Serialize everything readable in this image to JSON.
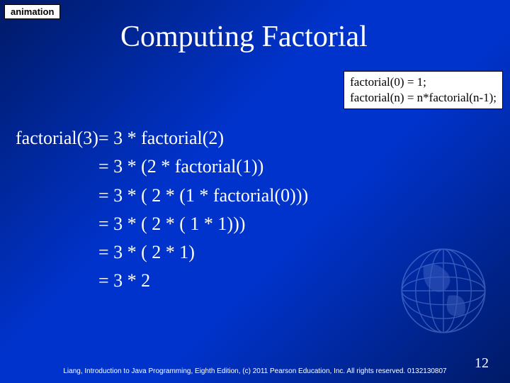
{
  "label": "animation",
  "title": "Computing Factorial",
  "definition": {
    "line1": "factorial(0) = 1;",
    "line2": "factorial(n) = n*factorial(n-1);"
  },
  "work": {
    "lhs": "factorial(3) ",
    "steps": [
      "= 3 * factorial(2)",
      "= 3 * (2 * factorial(1))",
      "= 3 * ( 2 * (1 * factorial(0)))",
      "= 3 * ( 2 * ( 1 * 1)))",
      "= 3 * ( 2 * 1)",
      "= 3 * 2"
    ]
  },
  "footer": "Liang, Introduction to Java Programming, Eighth Edition, (c) 2011 Pearson Education, Inc. All rights reserved. 0132130807",
  "page": "12"
}
